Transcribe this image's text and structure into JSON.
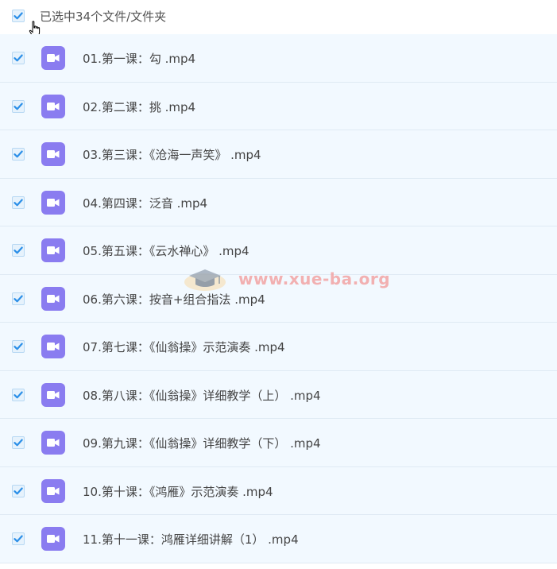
{
  "header": {
    "selection_text": "已选中34个文件/文件夹"
  },
  "files": [
    {
      "name": "01.第一课：勾 .mp4"
    },
    {
      "name": "02.第二课：挑 .mp4"
    },
    {
      "name": "03.第三课：《沧海一声笑》 .mp4"
    },
    {
      "name": "04.第四课：泛音 .mp4"
    },
    {
      "name": "05.第五课：《云水禅心》 .mp4"
    },
    {
      "name": "06.第六课：按音+组合指法 .mp4"
    },
    {
      "name": "07.第七课：《仙翁操》示范演奏 .mp4"
    },
    {
      "name": "08.第八课：《仙翁操》详细教学（上） .mp4"
    },
    {
      "name": "09.第九课：《仙翁操》详细教学（下） .mp4"
    },
    {
      "name": "10.第十课：《鸿雁》示范演奏 .mp4"
    },
    {
      "name": "11.第十一课：鸿雁详细讲解（1） .mp4"
    }
  ],
  "watermark": {
    "text": "www.xue-ba.org"
  },
  "colors": {
    "row_bg": "#f2f9ff",
    "checkbox_check": "#2b8fe8",
    "video_icon_bg": "#8a7cf0"
  },
  "icons": {
    "checkbox": "checkbox-checked-icon",
    "file": "video-file-icon",
    "cursor": "hand-pointer-icon"
  }
}
